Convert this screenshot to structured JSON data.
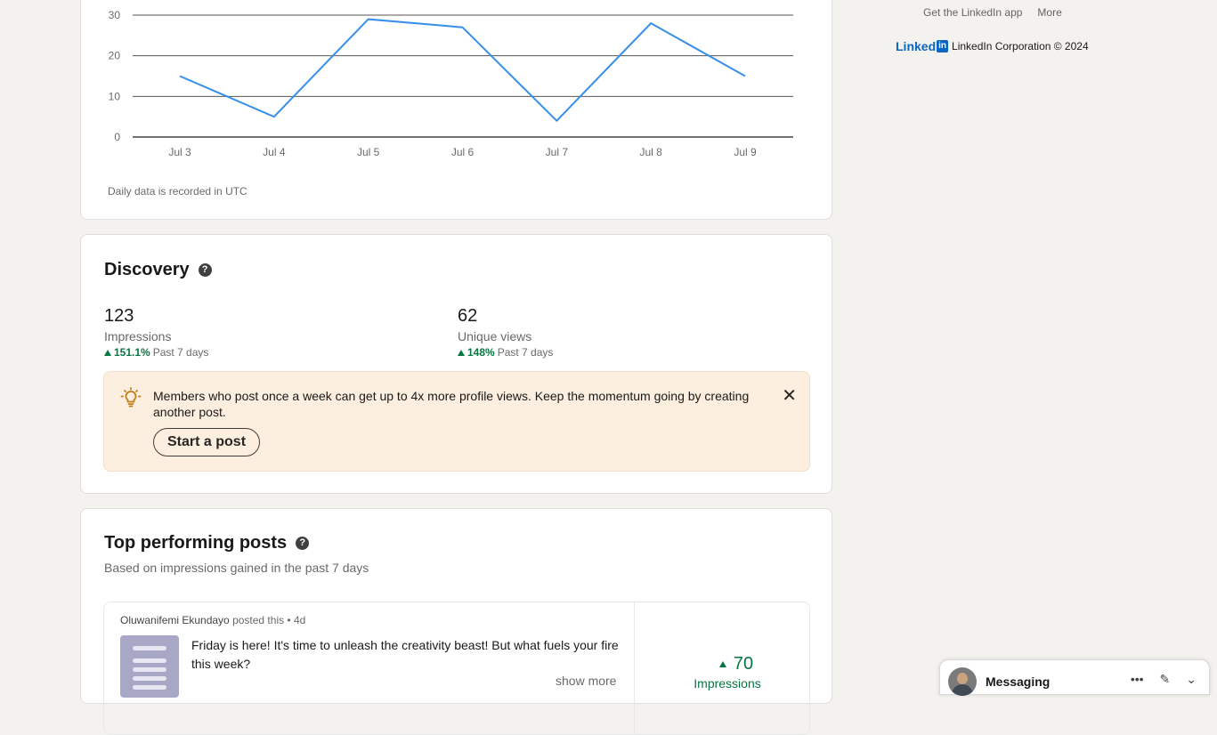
{
  "chart_data": {
    "type": "line",
    "categories": [
      "Jul 3",
      "Jul 4",
      "Jul 5",
      "Jul 6",
      "Jul 7",
      "Jul 8",
      "Jul 9"
    ],
    "values": [
      15,
      5,
      29,
      27,
      4,
      28,
      15
    ],
    "ylim": [
      0,
      30
    ],
    "yticks": [
      0,
      10,
      20,
      30
    ],
    "grid": true,
    "line_color": "#378fe9"
  },
  "chart_note": "Daily data is recorded in UTC",
  "discovery": {
    "title": "Discovery",
    "impressions": {
      "value": "123",
      "label": "Impressions",
      "change": "151.1%",
      "period": "Past 7 days"
    },
    "unique_views": {
      "value": "62",
      "label": "Unique views",
      "change": "148%",
      "period": "Past 7 days"
    },
    "tip": {
      "icon": "lightbulb-icon",
      "text": "Members who post once a week can get up to 4x more profile views. Keep the momentum going by creating another post.",
      "button": "Start a post"
    }
  },
  "top_posts": {
    "title": "Top performing posts",
    "subtitle": "Based on impressions gained in the past 7 days",
    "post": {
      "author": "Oluwanifemi Ekundayo",
      "meta": " posted this • 4d",
      "text": "Friday is here! It's time to unleash the creativity beast! But what fuels your fire this week?",
      "show_more": "show more",
      "stat_value": "70",
      "stat_label": "Impressions"
    }
  },
  "footer": {
    "links": [
      "Get the LinkedIn app",
      "More"
    ],
    "brand_word": "Linked",
    "brand_box": "in",
    "copyright": "LinkedIn Corporation © 2024"
  },
  "messaging": {
    "title": "Messaging"
  },
  "colors": {
    "accent_green": "#057642",
    "brand_blue": "#0a66c2",
    "tip_bg": "#fcefe0"
  }
}
